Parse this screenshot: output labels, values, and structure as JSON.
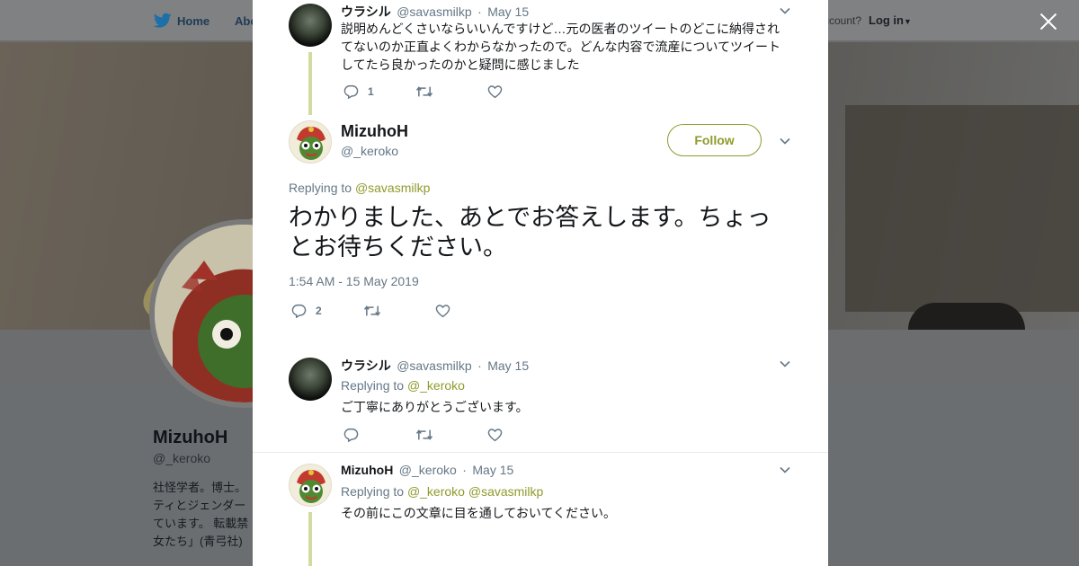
{
  "background": {
    "nav": {
      "home_label": "Home",
      "about_label": "Abo",
      "account_prompt": "ccount?",
      "login_label": "Log in"
    },
    "profile": {
      "name": "MizuhoH",
      "handle": "@_keroko",
      "bio_lines": [
        "社怪学者。博士。",
        "ティとジェンダー",
        "ています。 転載禁",
        "女たち」(青弓社)"
      ]
    }
  },
  "modal": {
    "tweets": [
      {
        "name": "ウラシル",
        "handle": "@savasmilkp",
        "dot": "·",
        "date": "May 15",
        "text": "説明めんどくさいならいいんですけど…元の医者のツイートのどこに納得されてないのか正直よくわからなかったので。どんな内容で流産についてツイートしてたら良かったのかと疑問に感じました",
        "reply_count": "1",
        "avatar": "dark-landscape"
      },
      {
        "name": "ウラシル",
        "handle": "@savasmilkp",
        "dot": "·",
        "date": "May 15",
        "replying_label": "Replying to",
        "replying_to": "@_keroko",
        "text": "ご丁寧にありがとうございます。",
        "reply_count": "",
        "avatar": "dark-landscape"
      },
      {
        "name": "MizuhoH",
        "handle": "@_keroko",
        "dot": "·",
        "date": "May 15",
        "replying_label": "Replying to",
        "replying_to_1": "@_keroko",
        "replying_to_2": "@savasmilkp",
        "text": "その前にこの文章に目を通しておいてください。",
        "avatar": "frog-character"
      }
    ],
    "main_tweet": {
      "name": "MizuhoH",
      "handle": "@_keroko",
      "follow_label": "Follow",
      "replying_label": "Replying to",
      "replying_to": "@savasmilkp",
      "text": "わかりました、あとでお答えします。ちょっとお待ちください。",
      "timestamp": "1:54 AM - 15 May 2019",
      "reply_count": "2"
    }
  },
  "icons": {
    "reply": "reply-icon",
    "retweet": "retweet-icon",
    "like": "heart-icon",
    "chevron": "chevron-down-icon",
    "close": "close-icon",
    "bird": "twitter-bird-icon"
  },
  "colors": {
    "accent": "#8f9b2c",
    "thread_line": "#d3dc9f",
    "muted": "#657786"
  }
}
